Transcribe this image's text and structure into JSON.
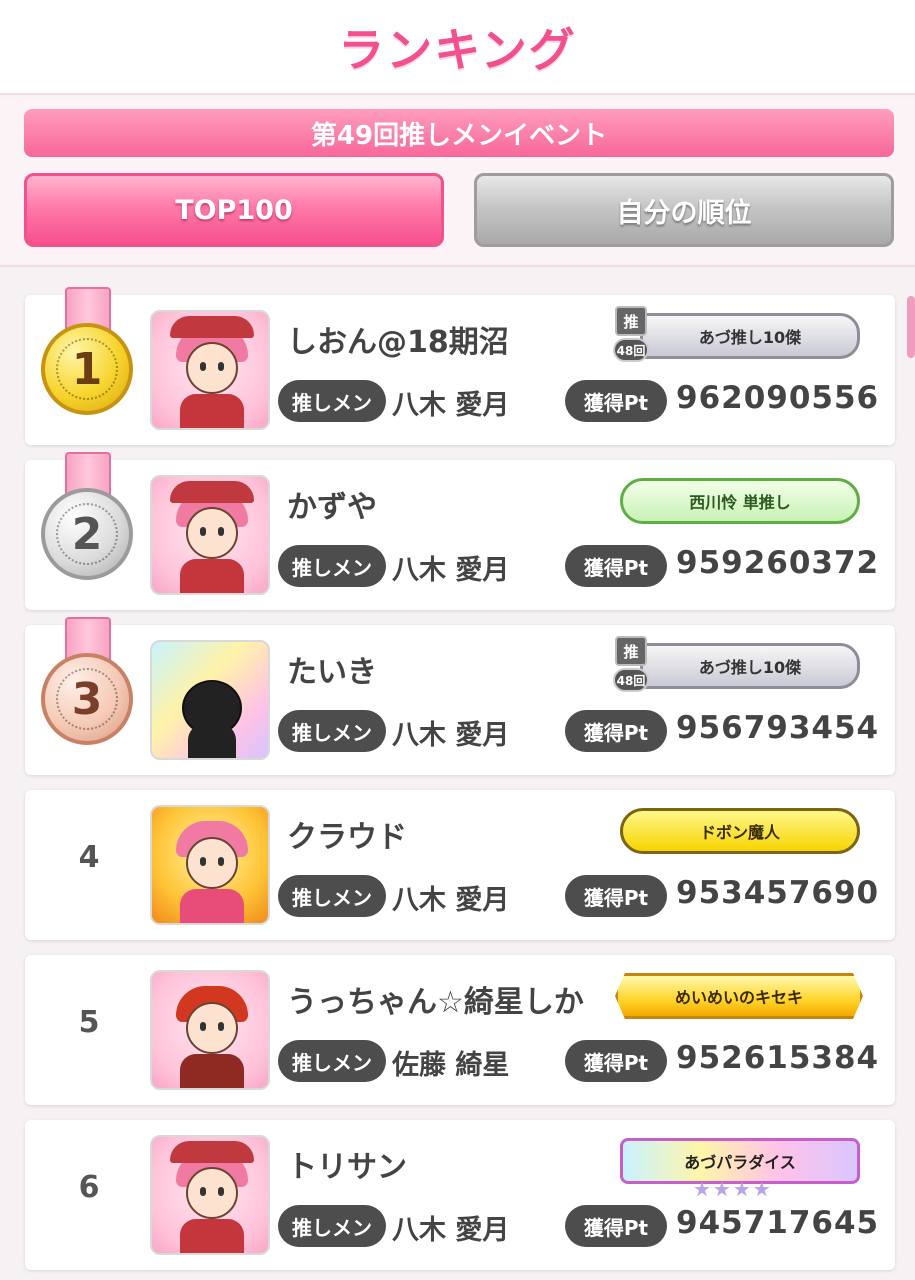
{
  "header": {
    "title": "ランキング"
  },
  "event": {
    "title": "第49回推しメンイベント"
  },
  "tabs": {
    "top100": "TOP100",
    "my_rank": "自分の順位"
  },
  "labels": {
    "oshi_label": "推しメン",
    "pt_label": "獲得Pt",
    "oshi_mark_top": "推",
    "oshi_mark_bottom": "48回"
  },
  "ranking": [
    {
      "rank": "1",
      "name": "しおん@18期沼",
      "oshi": "八木 愛月",
      "points": "962090556",
      "title": "あづ推し10傑",
      "title_style": "silver",
      "medal": "gold"
    },
    {
      "rank": "2",
      "name": "かずや",
      "oshi": "八木 愛月",
      "points": "959260372",
      "title": "西川怜 単推し",
      "title_style": "green",
      "medal": "silver"
    },
    {
      "rank": "3",
      "name": "たいき",
      "oshi": "八木 愛月",
      "points": "956793454",
      "title": "あづ推し10傑",
      "title_style": "silver",
      "medal": "bronze"
    },
    {
      "rank": "4",
      "name": "クラウド",
      "oshi": "八木 愛月",
      "points": "953457690",
      "title": "ドボン魔人",
      "title_style": "yellow"
    },
    {
      "rank": "5",
      "name": "うっちゃん☆綺星しか",
      "oshi": "佐藤 綺星",
      "points": "952615384",
      "title": "めいめいのキセキ",
      "title_style": "gold"
    },
    {
      "rank": "6",
      "name": "トリサン",
      "oshi": "八木 愛月",
      "points": "945717645",
      "title": "あづパラダイス",
      "title_style": "rainbow"
    }
  ]
}
